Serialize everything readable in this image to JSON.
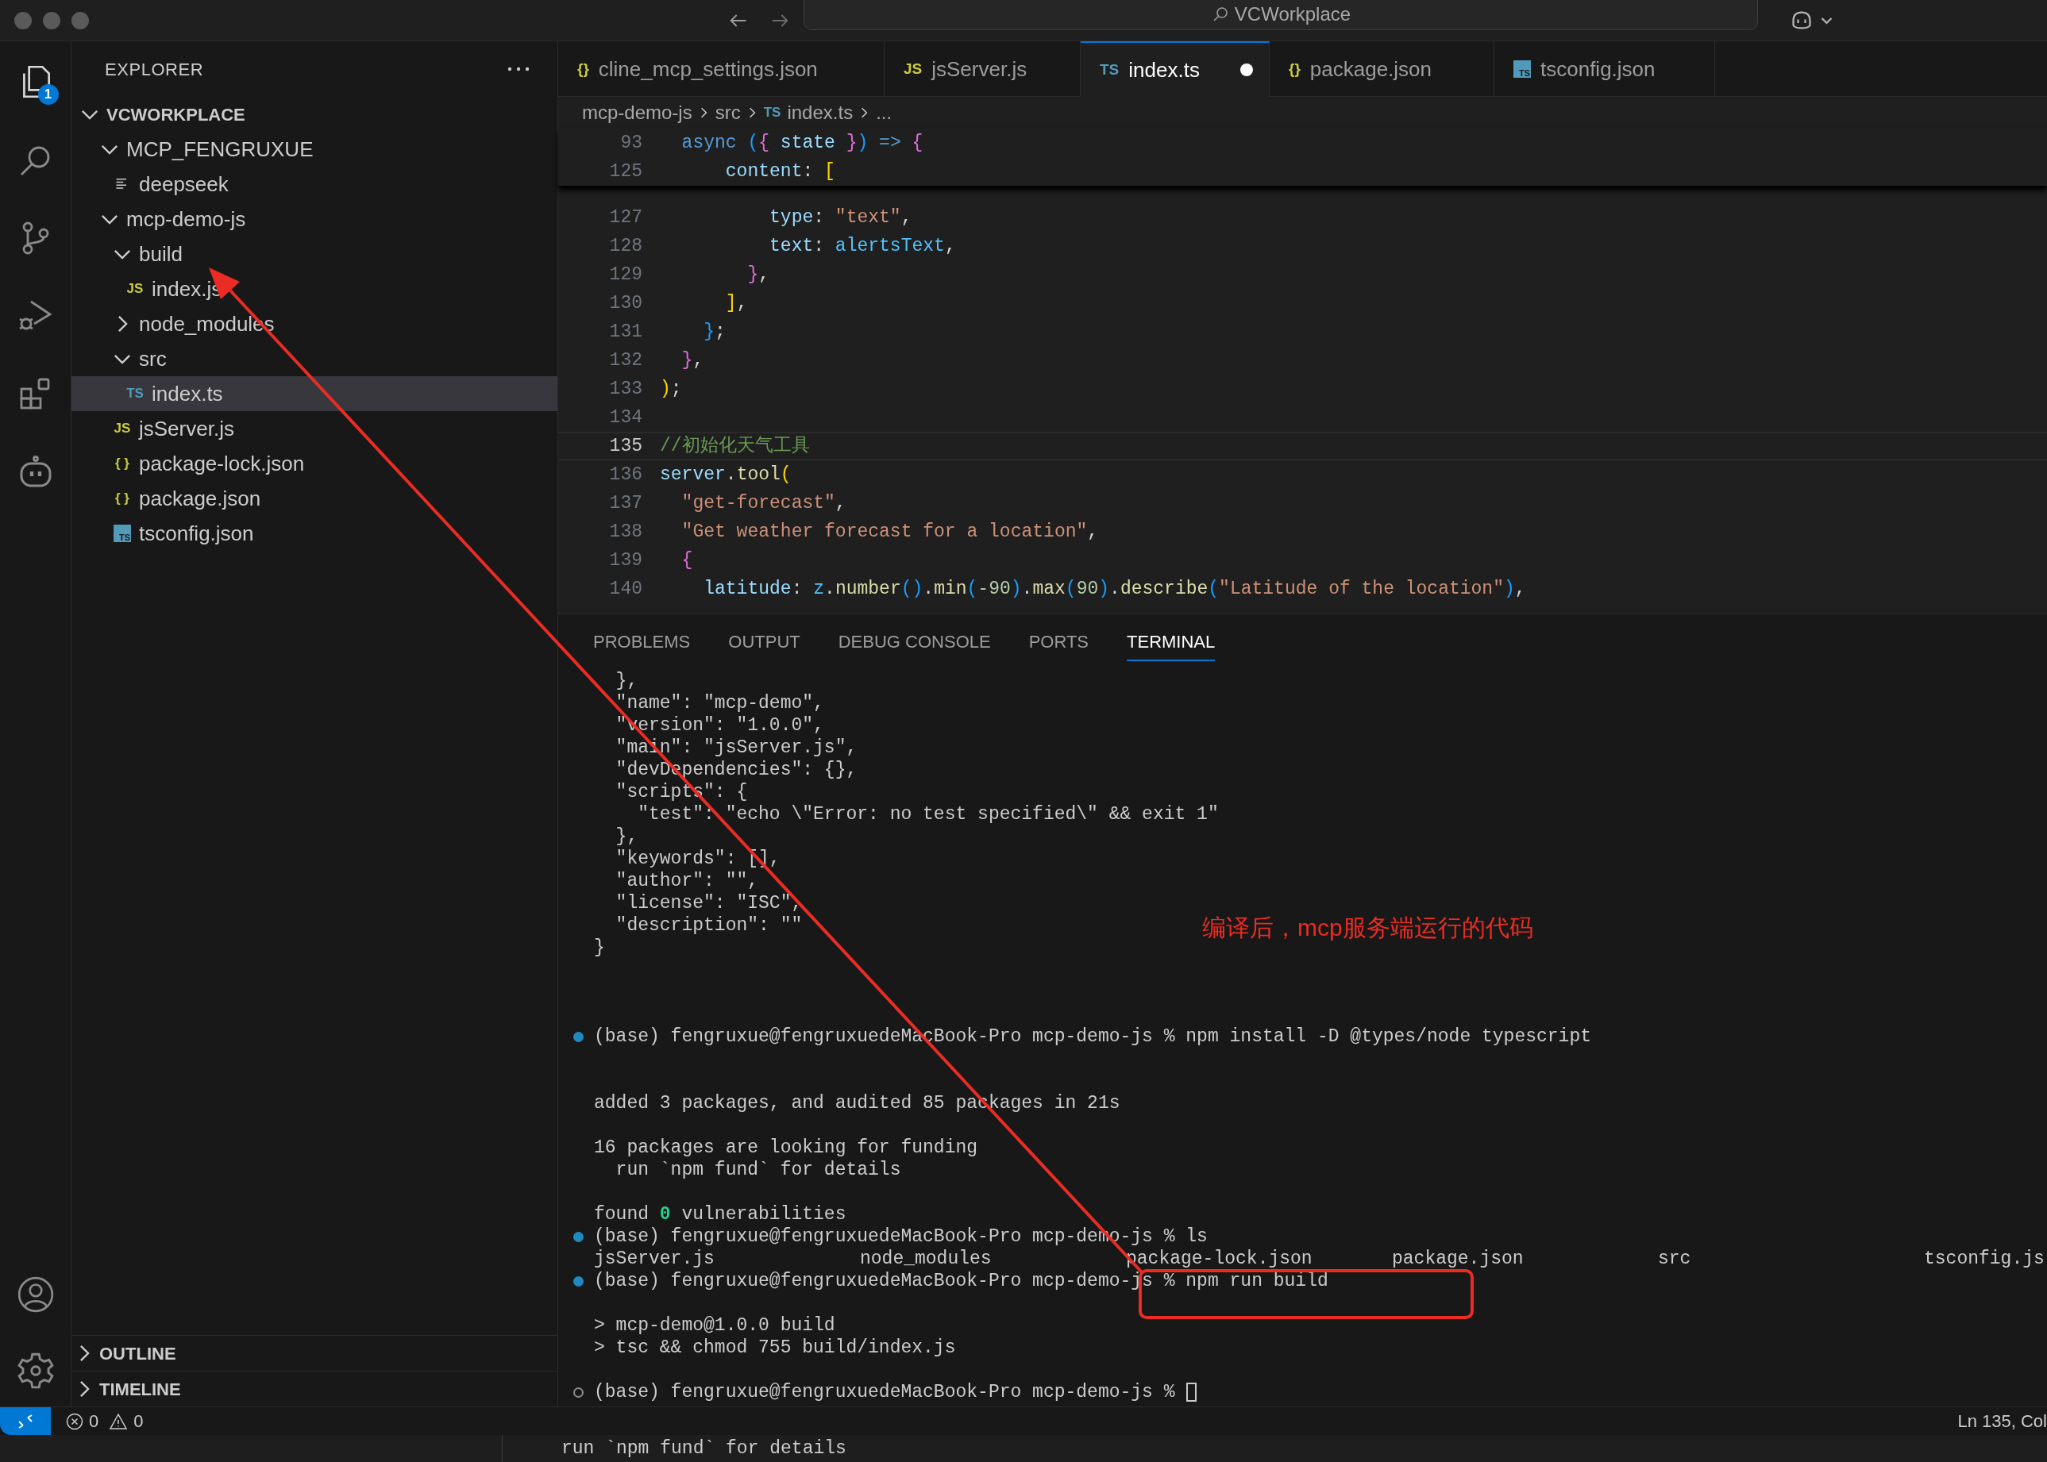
{
  "title_bar": {
    "search": "VCWorkplace"
  },
  "activity_bar": {
    "badge": "1"
  },
  "sidebar": {
    "title": "EXPLORER",
    "tree": [
      {
        "label": "VCWORKPLACE",
        "kind": "root",
        "expanded": true,
        "selected": false,
        "children": [
          {
            "label": "MCP_FENGRUXUE",
            "kind": "folder",
            "expanded": true,
            "selected": false,
            "children": [
              {
                "label": "deepseek",
                "kind": "text",
                "selected": false
              }
            ]
          },
          {
            "label": "mcp-demo-js",
            "kind": "folder",
            "expanded": true,
            "selected": false,
            "children": [
              {
                "label": "build",
                "kind": "folder",
                "expanded": true,
                "selected": false,
                "children": [
                  {
                    "label": "index.js",
                    "kind": "js",
                    "glyph": "JS",
                    "selected": false
                  }
                ]
              },
              {
                "label": "node_modules",
                "kind": "folder",
                "expanded": false,
                "selected": false
              },
              {
                "label": "src",
                "kind": "folder",
                "expanded": true,
                "selected": false,
                "children": [
                  {
                    "label": "index.ts",
                    "kind": "ts",
                    "glyph": "TS",
                    "selected": true
                  }
                ]
              },
              {
                "label": "jsServer.js",
                "kind": "js",
                "glyph": "JS",
                "selected": false
              },
              {
                "label": "package-lock.json",
                "kind": "json",
                "glyph": "{ }",
                "selected": false
              },
              {
                "label": "package.json",
                "kind": "json",
                "glyph": "{ }",
                "selected": false
              },
              {
                "label": "tsconfig.json",
                "kind": "tsconfig",
                "glyph": "TS",
                "selected": false
              }
            ]
          }
        ]
      }
    ],
    "sections": [
      {
        "label": "OUTLINE",
        "expanded": false
      },
      {
        "label": "TIMELINE",
        "expanded": false
      }
    ]
  },
  "tabs": [
    {
      "label": "cline_mcp_settings.json",
      "kind": "json",
      "glyph": "{}",
      "selected": false,
      "modified": false
    },
    {
      "label": "jsServer.js",
      "kind": "js",
      "glyph": "JS",
      "selected": false,
      "modified": false
    },
    {
      "label": "index.ts",
      "kind": "ts",
      "glyph": "TS",
      "selected": true,
      "modified": true
    },
    {
      "label": "package.json",
      "kind": "json",
      "glyph": "{}",
      "selected": false,
      "modified": false
    },
    {
      "label": "tsconfig.json",
      "kind": "tsconfig",
      "glyph": "TS",
      "selected": false,
      "modified": false
    }
  ],
  "breadcrumb": [
    {
      "label": "mcp-demo-js"
    },
    {
      "label": "src"
    },
    {
      "label": "index.ts",
      "kind": "ts",
      "glyph": "TS"
    },
    {
      "label": "..."
    }
  ],
  "editor": {
    "sticky": [
      {
        "number": "93",
        "tokens": [
          {
            "text": "  async ",
            "kind": "keyword"
          },
          {
            "text": "(",
            "kind": "bracket3"
          },
          {
            "text": "{",
            "kind": "bracket2"
          },
          {
            "text": " state ",
            "kind": "property"
          },
          {
            "text": "}",
            "kind": "bracket2"
          },
          {
            "text": ")",
            "kind": "bracket3"
          },
          {
            "text": " => ",
            "kind": "keyword"
          },
          {
            "text": "{",
            "kind": "bracket2"
          }
        ]
      },
      {
        "number": "125",
        "tokens": [
          {
            "text": "      content",
            "kind": "property"
          },
          {
            "text": ": "
          },
          {
            "text": "[",
            "kind": "bracket1"
          }
        ]
      }
    ],
    "lines": [
      {
        "number": "127",
        "current": false,
        "tokens": [
          {
            "text": "          type",
            "kind": "property"
          },
          {
            "text": ": "
          },
          {
            "text": "\"text\"",
            "kind": "string"
          },
          {
            "text": ","
          }
        ]
      },
      {
        "number": "128",
        "current": false,
        "tokens": [
          {
            "text": "          text",
            "kind": "property"
          },
          {
            "text": ": "
          },
          {
            "text": "alertsText",
            "kind": "variable"
          },
          {
            "text": ","
          }
        ]
      },
      {
        "number": "129",
        "current": false,
        "tokens": [
          {
            "text": "        }",
            "kind": "bracket2"
          },
          {
            "text": ","
          }
        ]
      },
      {
        "number": "130",
        "current": false,
        "tokens": [
          {
            "text": "      ]",
            "kind": "bracket1"
          },
          {
            "text": ","
          }
        ]
      },
      {
        "number": "131",
        "current": false,
        "tokens": [
          {
            "text": "    }",
            "kind": "bracket3"
          },
          {
            "text": ";"
          }
        ]
      },
      {
        "number": "132",
        "current": false,
        "tokens": [
          {
            "text": "  }",
            "kind": "bracket2"
          },
          {
            "text": ","
          }
        ]
      },
      {
        "number": "133",
        "current": false,
        "tokens": [
          {
            "text": ")",
            "kind": "bracket1"
          },
          {
            "text": ";"
          }
        ]
      },
      {
        "number": "134",
        "current": false
      },
      {
        "number": "135",
        "current": true,
        "tokens": [
          {
            "text": "//初始化天气工具",
            "kind": "comment"
          }
        ]
      },
      {
        "number": "136",
        "current": false,
        "tokens": [
          {
            "text": "server",
            "kind": "property"
          },
          {
            "text": "."
          },
          {
            "text": "tool",
            "kind": "function"
          },
          {
            "text": "(",
            "kind": "bracket1"
          }
        ]
      },
      {
        "number": "137",
        "current": false,
        "tokens": [
          {
            "text": "  \"get-forecast\"",
            "kind": "string"
          },
          {
            "text": ","
          }
        ]
      },
      {
        "number": "138",
        "current": false,
        "tokens": [
          {
            "text": "  \"Get weather forecast for a location\"",
            "kind": "string"
          },
          {
            "text": ","
          }
        ]
      },
      {
        "number": "139",
        "current": false,
        "tokens": [
          {
            "text": "  {",
            "kind": "bracket2"
          }
        ]
      },
      {
        "number": "140",
        "current": false,
        "tokens": [
          {
            "text": "    latitude",
            "kind": "property"
          },
          {
            "text": ": "
          },
          {
            "text": "z",
            "kind": "variable"
          },
          {
            "text": "."
          },
          {
            "text": "number",
            "kind": "function"
          },
          {
            "text": "()",
            "kind": "bracket3"
          },
          {
            "text": "."
          },
          {
            "text": "min",
            "kind": "function"
          },
          {
            "text": "(",
            "kind": "bracket3"
          },
          {
            "text": "-90",
            "kind": "number"
          },
          {
            "text": ")",
            "kind": "bracket3"
          },
          {
            "text": "."
          },
          {
            "text": "max",
            "kind": "function"
          },
          {
            "text": "(",
            "kind": "bracket3"
          },
          {
            "text": "90",
            "kind": "number"
          },
          {
            "text": ")",
            "kind": "bracket3"
          },
          {
            "text": "."
          },
          {
            "text": "describe",
            "kind": "function"
          },
          {
            "text": "(",
            "kind": "bracket3"
          },
          {
            "text": "\"Latitude of the location\"",
            "kind": "string"
          },
          {
            "text": ")",
            "kind": "bracket3"
          },
          {
            "text": ","
          }
        ]
      }
    ]
  },
  "panel": {
    "tabs": [
      {
        "label": "PROBLEMS",
        "selected": false
      },
      {
        "label": "OUTPUT",
        "selected": false
      },
      {
        "label": "DEBUG CONSOLE",
        "selected": false
      },
      {
        "label": "PORTS",
        "selected": false
      },
      {
        "label": "TERMINAL",
        "selected": true
      }
    ],
    "terminal": [
      {
        "kind": "output",
        "text": "  },"
      },
      {
        "kind": "output",
        "text": "  \"name\": \"mcp-demo\","
      },
      {
        "kind": "output",
        "text": "  \"version\": \"1.0.0\","
      },
      {
        "kind": "output",
        "text": "  \"main\": \"jsServer.js\","
      },
      {
        "kind": "output",
        "text": "  \"devDependencies\": {},"
      },
      {
        "kind": "output",
        "text": "  \"scripts\": {"
      },
      {
        "kind": "output",
        "text": "    \"test\": \"echo \\\"Error: no test specified\\\" && exit 1\""
      },
      {
        "kind": "output",
        "text": "  },"
      },
      {
        "kind": "output",
        "text": "  \"keywords\": [],"
      },
      {
        "kind": "output",
        "text": "  \"author\": \"\","
      },
      {
        "kind": "output",
        "text": "  \"license\": \"ISC\","
      },
      {
        "kind": "output",
        "text": "  \"description\": \"\""
      },
      {
        "kind": "output",
        "text": "}"
      },
      {
        "kind": "blank"
      },
      {
        "kind": "blank"
      },
      {
        "kind": "blank"
      },
      {
        "kind": "prompt",
        "done": true,
        "text": "(base) fengruxue@fengruxuedeMacBook-Pro mcp-demo-js % npm install -D @types/node typescript"
      },
      {
        "kind": "blank"
      },
      {
        "kind": "blank"
      },
      {
        "kind": "output",
        "text": "added 3 packages, and audited 85 packages in 21s"
      },
      {
        "kind": "blank"
      },
      {
        "kind": "output",
        "text": "16 packages are looking for funding"
      },
      {
        "kind": "output",
        "text": "  run `npm fund` for details"
      },
      {
        "kind": "blank"
      },
      {
        "kind": "parts",
        "parts": [
          {
            "text": "found "
          },
          {
            "text": "0",
            "kind": "success"
          },
          {
            "text": " vulnerabilities"
          }
        ]
      },
      {
        "kind": "prompt",
        "done": true,
        "text": "(base) fengruxue@fengruxuedeMacBook-Pro mcp-demo-js % ls"
      },
      {
        "kind": "columns",
        "cells": [
          "jsServer.js",
          "node_modules",
          "package-lock.json",
          "package.json",
          "src",
          "tsconfig.js"
        ]
      },
      {
        "kind": "prompt",
        "done": true,
        "text": "(base) fengruxue@fengruxuedeMacBook-Pro mcp-demo-js % npm run build"
      },
      {
        "kind": "blank"
      },
      {
        "kind": "output",
        "text": "> mcp-demo@1.0.0 build"
      },
      {
        "kind": "output",
        "text": "> tsc && chmod 755 build/index.js"
      },
      {
        "kind": "blank"
      },
      {
        "kind": "prompt",
        "done": false,
        "cursor": true,
        "text": "(base) fengruxue@fengruxuedeMacBook-Pro mcp-demo-js %"
      }
    ]
  },
  "status_bar": {
    "errors": "0",
    "warnings": "0",
    "position": "Ln 135, Col"
  },
  "background_window": {
    "text": "run `npm fund` for details"
  },
  "annotation": {
    "note": "编译后，mcp服务端运行的代码"
  }
}
